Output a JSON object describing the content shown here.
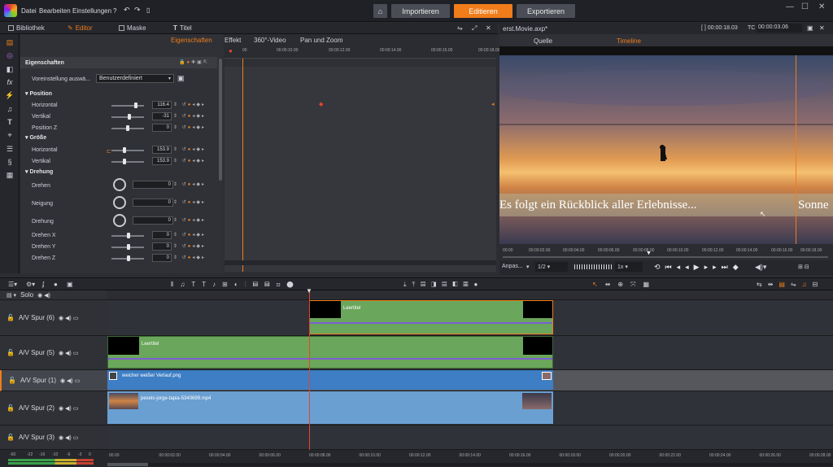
{
  "menu": {
    "file": "Datei",
    "edit": "Bearbeiten",
    "settings": "Einstellungen",
    "help": "?"
  },
  "modes": {
    "import": "Importieren",
    "edit": "Editieren",
    "export": "Exportieren"
  },
  "window": {
    "minimize": "—",
    "maximize": "☐",
    "close": "✕"
  },
  "left_tabs": {
    "library": "Bibliothek",
    "editor": "Editor",
    "mask": "Maske",
    "title": "Titel"
  },
  "fx_tabs": {
    "properties": "Eigenschaften",
    "effect": "Effekt",
    "video360": "360°-Video",
    "panzoom": "Pan und Zoom"
  },
  "fx_ruler": [
    "00",
    "00:00:10.00",
    "00:00:12.00",
    "00:00:14.00",
    "00:00:16.00",
    "00:00:18.00"
  ],
  "props": {
    "header": "Eigenschaften",
    "preset_label": "Voreinstellung auswä...",
    "preset_value": "Benutzerdefiniert",
    "sec_position": "Position",
    "horizontal": "Horizontal",
    "h_val": "116.4",
    "vertikal": "Vertikal",
    "v_val": "-31",
    "position_z": "Position Z",
    "z_val": "0",
    "sec_size": "Größe",
    "size_h": "Horizontal",
    "size_h_val": "153.9",
    "size_v": "Vertikal",
    "size_v_val": "153.9",
    "sec_rotation": "Drehung",
    "drehen": "Drehen",
    "drehen_val": "0",
    "neigung": "Neigung",
    "neigung_val": "0",
    "drehung": "Drehung",
    "drehung_val": "0",
    "drehen_x": "Drehen X",
    "dx_val": "0",
    "drehen_y": "Drehen Y",
    "dy_val": "0",
    "drehen_z": "Drehen Z",
    "dz_val": "0"
  },
  "preview": {
    "project": "erst.Movie.axp*",
    "time1": "[ ] 00:00:18.03",
    "tc_label": "TC",
    "time2": "00:00:03.06",
    "tab_source": "Quelle",
    "tab_timeline": "Timeline",
    "subtitle": "Es folgt ein Rückblick aller Erlebnisse...",
    "subtitle_cut": "Sonne",
    "ruler": [
      "00:00",
      "00:00:02.00",
      "00:00:04.00",
      "00:00:06.00",
      "00:00:08.00",
      "00:00:10.00",
      "00:00:12.00",
      "00:00:14.00",
      "00:00:16.00",
      "00:00:18.00"
    ],
    "fit": "Anpas...",
    "ratio": "1/2",
    "speed": "1x"
  },
  "tracks": [
    {
      "name": "Solo"
    },
    {
      "name": "A/V Spur (6)",
      "clip": "Leertitel"
    },
    {
      "name": "A/V Spur (5)",
      "clip": "Leertitel"
    },
    {
      "name": "A/V Spur (1)",
      "clip": "weicher weißer Verlauf.png"
    },
    {
      "name": "A/V Spur (2)",
      "clip": "pexels-jorge-tapia-5340699.mp4"
    },
    {
      "name": "A/V Spur (3)"
    }
  ],
  "tl_ruler": [
    "00.00",
    "00:00:02.00",
    "00:00:04.00",
    "00:00:06.00",
    "00:00:08.00",
    "00:00:10.00",
    "00:00:12.00",
    "00:00:14.00",
    "00:00:16.00",
    "00:00:18.00",
    "00:00:20.00",
    "00:00:22.00",
    "00:00:24.00",
    "00:00:26.00",
    "00:00:28.00"
  ],
  "meter_labels": [
    "-60",
    "-22",
    "-16",
    "-10",
    "-6",
    "-3",
    "0"
  ],
  "colors": {
    "accent": "#f07c1a",
    "title_clip": "#6aa65b",
    "image_clip": "#3d7ec4",
    "video_clip": "#6a9fd2"
  }
}
